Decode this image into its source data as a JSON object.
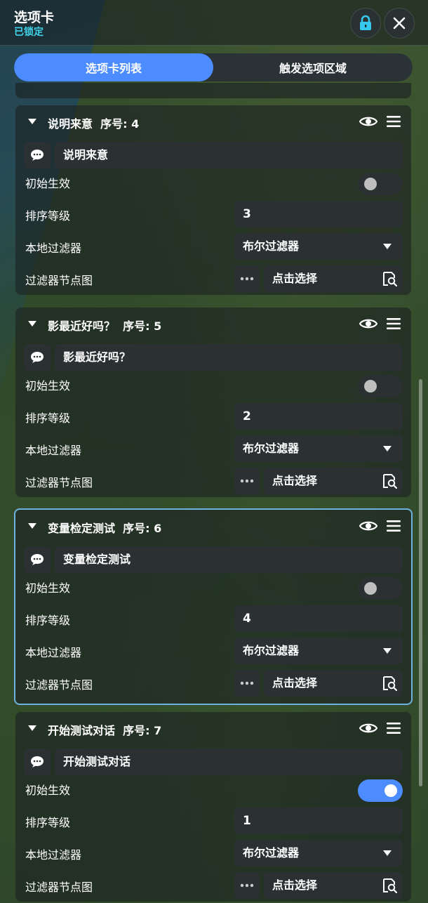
{
  "header": {
    "title": "选项卡",
    "status": "已锁定",
    "lock_icon": "lock-icon",
    "close_icon": "close-icon"
  },
  "tabs": [
    {
      "label": "选项卡列表",
      "active": true
    },
    {
      "label": "触发选项区域",
      "active": false
    }
  ],
  "field_labels": {
    "initial_active": "初始生效",
    "sort_level": "排序等级",
    "local_filter": "本地过滤器",
    "filter_graph": "过滤器节点图"
  },
  "cards": [
    {
      "name": "说明来意",
      "index_label": "序号: 4",
      "text": "说明来意",
      "initial_active": false,
      "sort_level": "3",
      "local_filter": "布尔过滤器",
      "filter_graph": "点击选择",
      "selected": false
    },
    {
      "name": "影最近好吗？",
      "index_label": "序号: 5",
      "text": "影最近好吗？",
      "initial_active": false,
      "sort_level": "2",
      "local_filter": "布尔过滤器",
      "filter_graph": "点击选择",
      "selected": false
    },
    {
      "name": "变量检定测试",
      "index_label": "序号: 6",
      "text": "变量检定测试",
      "initial_active": false,
      "sort_level": "4",
      "local_filter": "布尔过滤器",
      "filter_graph": "点击选择",
      "selected": true
    },
    {
      "name": "开始测试对话",
      "index_label": "序号: 7",
      "text": "开始测试对话",
      "initial_active": true,
      "sort_level": "1",
      "local_filter": "布尔过滤器",
      "filter_graph": "点击选择",
      "selected": false
    }
  ],
  "colors": {
    "accent": "#4c8cff",
    "status": "#3fd2e8",
    "selected_border": "#6fb2e0"
  }
}
